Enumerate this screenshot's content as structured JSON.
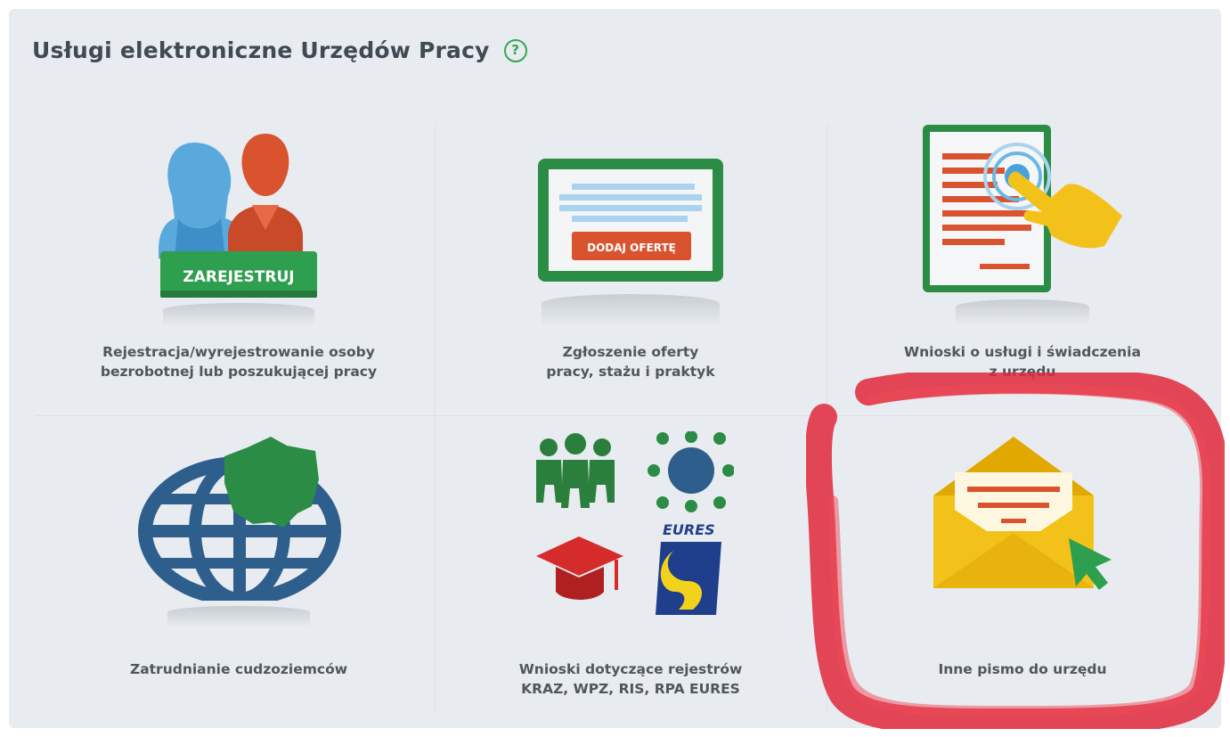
{
  "header": {
    "title": "Usługi elektroniczne Urzędów Pracy",
    "help_icon": "question-circle-icon",
    "help_glyph": "?"
  },
  "colors": {
    "panel_bg": "#e8ebef",
    "green": "#2e9e4f",
    "dark_green": "#2a7f3c",
    "blue": "#2e5e8c",
    "red_annotation": "#e0283a",
    "yellow": "#f2c21b"
  },
  "tiles": [
    {
      "label": "Rejestracja/wyrejestrowanie osoby\nbezrobotnej lub poszukującej pracy",
      "icon": "people-register-icon",
      "badge_text": "ZAREJESTRUJ"
    },
    {
      "label": "Zgłoszenie oferty\npracy, stażu i praktyk",
      "icon": "job-offer-icon",
      "badge_text": "DODAJ OFERTĘ"
    },
    {
      "label": "Wnioski o usługi i świadczenia\nz urzędu",
      "icon": "document-touch-icon"
    },
    {
      "label": "Zatrudnianie cudzoziemców",
      "icon": "globe-poland-icon"
    },
    {
      "label": "Wnioski dotyczące rejestrów\nKRAZ, WPZ, RIS, RPA EURES",
      "icon": "registers-icon",
      "eures_text": "EURES"
    },
    {
      "label": "Inne pismo do urzędu",
      "icon": "envelope-click-icon"
    }
  ]
}
